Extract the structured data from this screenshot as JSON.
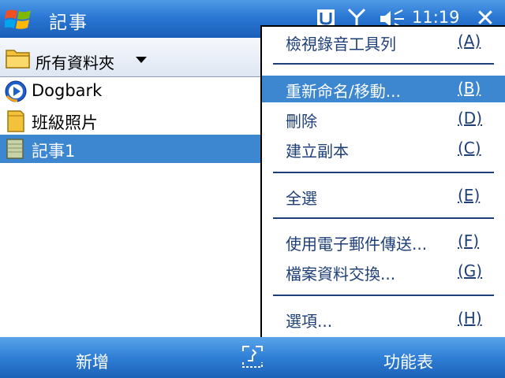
{
  "titlebar": {
    "title": "記事",
    "clock": "11:19",
    "close_glyph": "✕"
  },
  "folderbar": {
    "label": "所有資料夾"
  },
  "files": [
    {
      "label": "Dogbark",
      "icon": "media-player-icon",
      "selected": false
    },
    {
      "label": "班級照片",
      "icon": "folder-icon",
      "selected": false
    },
    {
      "label": "記事1",
      "icon": "note-icon",
      "selected": true
    }
  ],
  "menu": {
    "items": [
      {
        "label": "檢視錄音工具列",
        "key": "(A)"
      },
      {
        "label": "重新命名/移動...",
        "key": "(B)",
        "highlight": true
      },
      {
        "label": "刪除",
        "key": "(D)"
      },
      {
        "label": "建立副本",
        "key": "(C)"
      },
      {
        "label": "全選",
        "key": "(E)"
      },
      {
        "label": "使用電子郵件傳送...",
        "key": "(F)"
      },
      {
        "label": "檔案資料交換...",
        "key": "(G)"
      },
      {
        "label": "選項...",
        "key": "(H)"
      }
    ]
  },
  "softkeys": {
    "left": "新增",
    "right": "功能表"
  },
  "colors": {
    "accent": "#3c87d0",
    "title_bar": "#2a78d4",
    "menu_text": "#1e3f78"
  }
}
